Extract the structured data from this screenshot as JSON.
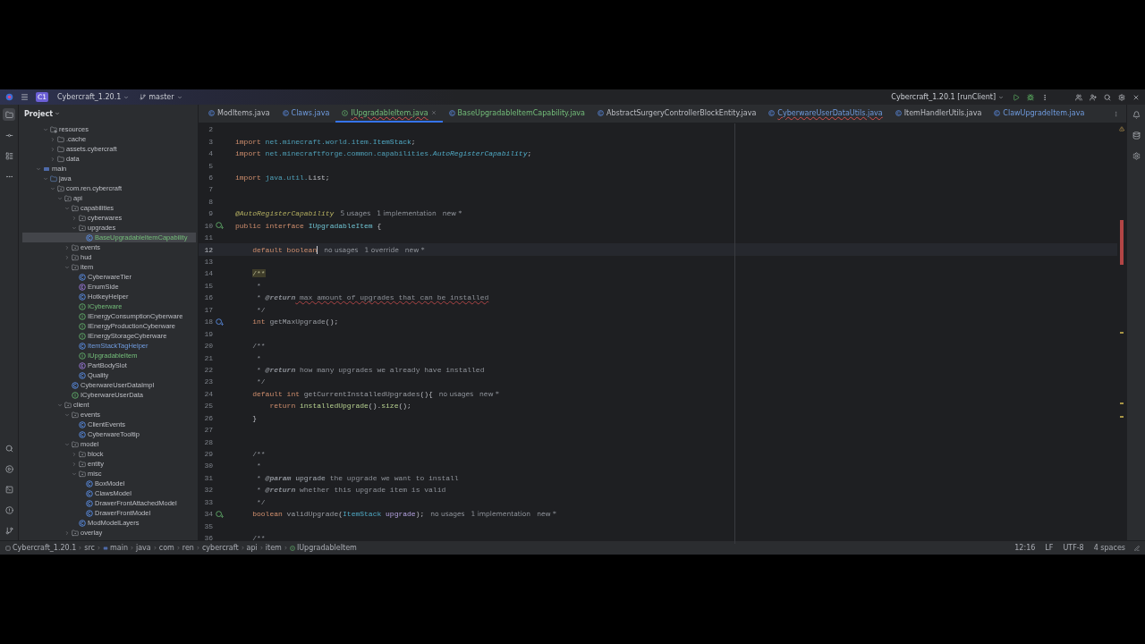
{
  "toolbar": {
    "project_badge": "C1",
    "project": "Cybercraft_1.20.1",
    "branch": "master",
    "run_config": "Cybercraft_1.20.1 [runClient]"
  },
  "project_panel": {
    "title": "Project",
    "tree": [
      {
        "children": [
          {
            "name": "resources",
            "kind": "resources",
            "expanded": true,
            "selected": false,
            "children": [
              {
                "name": ".cache",
                "kind": "folder",
                "expanded": false,
                "selected": false
              },
              {
                "name": "assets.cybercraft",
                "kind": "folder",
                "expanded": false,
                "selected": false
              },
              {
                "name": "data",
                "kind": "folder",
                "expanded": false,
                "selected": false
              }
            ]
          }
        ]
      },
      {
        "name": "main",
        "kind": "module",
        "expanded": true,
        "selected": false,
        "children": [
          {
            "name": "java",
            "kind": "source",
            "expanded": true,
            "selected": false,
            "children": [
              {
                "name": "com.ren.cybercraft",
                "kind": "package",
                "expanded": true,
                "selected": false,
                "children": [
                  {
                    "name": "api",
                    "kind": "package",
                    "expanded": true,
                    "selected": false,
                    "children": [
                      {
                        "name": "capabilities",
                        "kind": "package",
                        "expanded": true,
                        "selected": false,
                        "children": [
                          {
                            "name": "cyberwares",
                            "kind": "package",
                            "expanded": false,
                            "selected": false
                          },
                          {
                            "name": "upgrades",
                            "kind": "package",
                            "expanded": true,
                            "selected": false,
                            "children": [
                              {
                                "name": "BaseUpgradableItemCapability",
                                "kind": "class",
                                "added": true,
                                "selected": true
                              }
                            ]
                          }
                        ]
                      },
                      {
                        "name": "events",
                        "kind": "package",
                        "expanded": false,
                        "selected": false
                      },
                      {
                        "name": "hud",
                        "kind": "package",
                        "expanded": false,
                        "selected": false
                      },
                      {
                        "name": "item",
                        "kind": "package",
                        "expanded": true,
                        "selected": false,
                        "children": [
                          {
                            "name": "CyberwareTier",
                            "kind": "class",
                            "selected": false
                          },
                          {
                            "name": "EnumSide",
                            "kind": "enum",
                            "selected": false
                          },
                          {
                            "name": "HotkeyHelper",
                            "kind": "class",
                            "selected": false
                          },
                          {
                            "name": "ICyberware",
                            "kind": "interface",
                            "added": true,
                            "selected": false
                          },
                          {
                            "name": "IEnergyConsumptionCyberware",
                            "kind": "interface",
                            "selected": false
                          },
                          {
                            "name": "IEnergyProductionCyberware",
                            "kind": "interface",
                            "selected": false
                          },
                          {
                            "name": "IEnergyStorageCyberware",
                            "kind": "interface",
                            "selected": false
                          },
                          {
                            "name": "ItemStackTagHelper",
                            "kind": "class",
                            "modified": true,
                            "selected": false
                          },
                          {
                            "name": "IUpgradableItem",
                            "kind": "interface",
                            "added": true,
                            "selected": false
                          },
                          {
                            "name": "PartBodySlot",
                            "kind": "enum",
                            "selected": false
                          },
                          {
                            "name": "Quality",
                            "kind": "class",
                            "selected": false
                          }
                        ]
                      },
                      {
                        "name": "CyberwareUserDataImpl",
                        "kind": "class",
                        "selected": false
                      },
                      {
                        "name": "ICyberwareUserData",
                        "kind": "interface",
                        "selected": false
                      }
                    ]
                  },
                  {
                    "name": "client",
                    "kind": "package",
                    "expanded": true,
                    "selected": false,
                    "children": [
                      {
                        "name": "events",
                        "kind": "package",
                        "expanded": true,
                        "selected": false,
                        "children": [
                          {
                            "name": "ClientEvents",
                            "kind": "class",
                            "selected": false
                          },
                          {
                            "name": "CyberwareTooltip",
                            "kind": "class",
                            "selected": false
                          }
                        ]
                      },
                      {
                        "name": "model",
                        "kind": "package",
                        "expanded": true,
                        "selected": false,
                        "children": [
                          {
                            "name": "block",
                            "kind": "package",
                            "expanded": false,
                            "selected": false
                          },
                          {
                            "name": "entity",
                            "kind": "package",
                            "expanded": false,
                            "selected": false
                          },
                          {
                            "name": "misc",
                            "kind": "package",
                            "expanded": true,
                            "selected": false,
                            "children": [
                              {
                                "name": "BoxModel",
                                "kind": "class",
                                "selected": false
                              },
                              {
                                "name": "ClawsModel",
                                "kind": "class",
                                "selected": false
                              },
                              {
                                "name": "DrawerFrontAttachedModel",
                                "kind": "class",
                                "selected": false
                              },
                              {
                                "name": "DrawerFrontModel",
                                "kind": "class",
                                "selected": false
                              }
                            ]
                          },
                          {
                            "name": "ModModelLayers",
                            "kind": "class",
                            "selected": false
                          }
                        ]
                      },
                      {
                        "name": "overlay",
                        "kind": "package",
                        "expanded": false,
                        "selected": false
                      }
                    ]
                  }
                ]
              }
            ]
          }
        ]
      }
    ]
  },
  "editor": {
    "tabs": [
      {
        "label": "ModItems.java",
        "kind": "class",
        "selected": false,
        "error": false
      },
      {
        "label": "Claws.java",
        "kind": "class",
        "modified": true,
        "selected": false,
        "error": false
      },
      {
        "label": "IUpgradableItem.java",
        "kind": "interface",
        "added": true,
        "selected": true,
        "error": true
      },
      {
        "label": "BaseUpgradableItemCapability.java",
        "kind": "class",
        "added": true,
        "selected": false,
        "error": false
      },
      {
        "label": "AbstractSurgeryControllerBlockEntity.java",
        "kind": "class",
        "selected": false,
        "error": false
      },
      {
        "label": "CyberwareUserDataUtils.java",
        "kind": "class",
        "modified": true,
        "selected": false,
        "error": true
      },
      {
        "label": "ItemHandlerUtils.java",
        "kind": "class",
        "selected": false,
        "error": false
      },
      {
        "label": "ClawUpgradeItem.java",
        "kind": "class",
        "modified": true,
        "selected": false,
        "error": false
      }
    ],
    "lines": [
      {
        "number": "2",
        "current": false
      },
      {
        "number": "3",
        "current": false,
        "tokens": [
          {
            "kind": "keyword",
            "text": "import"
          },
          {
            "kind": "package",
            "text": " net.minecraft.world.item."
          },
          {
            "kind": "type",
            "text": "ItemStack"
          },
          {
            "kind": "plain",
            "text": ";"
          }
        ]
      },
      {
        "number": "4",
        "current": false,
        "tokens": [
          {
            "kind": "keyword",
            "text": "import"
          },
          {
            "kind": "package",
            "text": " net.minecraftforge.common.capabilities."
          },
          {
            "kind": "italic",
            "text": "AutoRegisterCapability"
          },
          {
            "kind": "plain",
            "text": ";"
          }
        ]
      },
      {
        "number": "5",
        "current": false
      },
      {
        "number": "6",
        "current": false,
        "tokens": [
          {
            "kind": "keyword",
            "text": "import"
          },
          {
            "kind": "package",
            "text": " java.util."
          },
          {
            "kind": "plain",
            "text": "List;"
          }
        ]
      },
      {
        "number": "7",
        "current": false
      },
      {
        "number": "8",
        "current": false
      },
      {
        "number": "9",
        "current": false,
        "tokens": [
          {
            "kind": "annotation",
            "text": "@AutoRegisterCapability"
          },
          {
            "kind": "hint",
            "text": "5 usages"
          },
          {
            "kind": "hint",
            "text": "1 implementation"
          },
          {
            "kind": "hint",
            "text": "new *"
          }
        ]
      },
      {
        "number": "10",
        "kind": "implemented",
        "current": false,
        "tokens": [
          {
            "kind": "keyword",
            "text": "public interface "
          },
          {
            "kind": "classname",
            "text": "IUpgradableItem"
          },
          {
            "kind": "plain",
            "text": " {"
          }
        ]
      },
      {
        "number": "11",
        "current": false
      },
      {
        "number": "12",
        "current": true,
        "tokens": [
          {
            "kind": "keyword",
            "text": "    default boolean"
          },
          {
            "kind": "hint",
            "text": "no usages"
          },
          {
            "kind": "hint",
            "text": "1 override"
          },
          {
            "kind": "hint",
            "text": "new *"
          }
        ]
      },
      {
        "number": "13",
        "current": false
      },
      {
        "number": "14",
        "current": false,
        "tokens": [
          {
            "kind": "doc-highlight",
            "text": "/**"
          }
        ]
      },
      {
        "number": "15",
        "current": false,
        "tokens": [
          {
            "kind": "comment",
            "text": "     *"
          }
        ]
      },
      {
        "number": "16",
        "current": false,
        "tokens": [
          {
            "kind": "comment",
            "text": "     * "
          },
          {
            "kind": "doc-tag",
            "text": "@return"
          },
          {
            "kind": "comment-error",
            "text": " max amount of upgrades that can be installed"
          }
        ]
      },
      {
        "number": "17",
        "current": false,
        "tokens": [
          {
            "kind": "comment",
            "text": "     */"
          }
        ]
      },
      {
        "number": "18",
        "kind": "overridden",
        "current": false,
        "tokens": [
          {
            "kind": "keyword",
            "text": "    int "
          },
          {
            "kind": "method-unused",
            "text": "getMaxUpgrade"
          },
          {
            "kind": "plain",
            "text": "();"
          }
        ]
      },
      {
        "number": "19",
        "current": false
      },
      {
        "number": "20",
        "current": false,
        "tokens": [
          {
            "kind": "comment",
            "text": "    /**"
          }
        ]
      },
      {
        "number": "21",
        "current": false,
        "tokens": [
          {
            "kind": "comment",
            "text": "     *"
          }
        ]
      },
      {
        "number": "22",
        "current": false,
        "tokens": [
          {
            "kind": "comment",
            "text": "     * "
          },
          {
            "kind": "doc-tag",
            "text": "@return"
          },
          {
            "kind": "comment",
            "text": " how many upgrades we already have installed"
          }
        ]
      },
      {
        "number": "23",
        "current": false,
        "tokens": [
          {
            "kind": "comment",
            "text": "     */"
          }
        ]
      },
      {
        "number": "24",
        "current": false,
        "tokens": [
          {
            "kind": "keyword",
            "text": "    default int "
          },
          {
            "kind": "method-unused",
            "text": "getCurrentInstalledUpgrades"
          },
          {
            "kind": "plain",
            "text": "(){"
          },
          {
            "kind": "hint",
            "text": "no usages"
          },
          {
            "kind": "hint",
            "text": "new *"
          }
        ]
      },
      {
        "number": "25",
        "current": false,
        "tokens": [
          {
            "kind": "keyword",
            "text": "        return "
          },
          {
            "kind": "method",
            "text": "installedUpgrade"
          },
          {
            "kind": "plain",
            "text": "()."
          },
          {
            "kind": "method",
            "text": "size"
          },
          {
            "kind": "plain",
            "text": "();"
          }
        ]
      },
      {
        "number": "26",
        "current": false,
        "tokens": [
          {
            "kind": "plain",
            "text": "    }"
          }
        ]
      },
      {
        "number": "27",
        "current": false
      },
      {
        "number": "28",
        "current": false
      },
      {
        "number": "29",
        "current": false,
        "tokens": [
          {
            "kind": "comment",
            "text": "    /**"
          }
        ]
      },
      {
        "number": "30",
        "current": false,
        "tokens": [
          {
            "kind": "comment",
            "text": "     *"
          }
        ]
      },
      {
        "number": "31",
        "current": false,
        "tokens": [
          {
            "kind": "comment",
            "text": "     * "
          },
          {
            "kind": "doc-tag",
            "text": "@param"
          },
          {
            "kind": "doc-param",
            "text": " upgrade"
          },
          {
            "kind": "comment",
            "text": " the upgrade we want to install"
          }
        ]
      },
      {
        "number": "32",
        "current": false,
        "tokens": [
          {
            "kind": "comment",
            "text": "     * "
          },
          {
            "kind": "doc-tag",
            "text": "@return"
          },
          {
            "kind": "comment",
            "text": " whether this upgrade item is valid"
          }
        ]
      },
      {
        "number": "33",
        "current": false,
        "tokens": [
          {
            "kind": "comment",
            "text": "     */"
          }
        ]
      },
      {
        "number": "34",
        "kind": "implemented",
        "current": false,
        "tokens": [
          {
            "kind": "keyword",
            "text": "    boolean "
          },
          {
            "kind": "method-unused",
            "text": "validUpgrade"
          },
          {
            "kind": "plain",
            "text": "("
          },
          {
            "kind": "type",
            "text": "ItemStack"
          },
          {
            "kind": "param",
            "text": " upgrade"
          },
          {
            "kind": "plain",
            "text": ");"
          },
          {
            "kind": "hint",
            "text": "no usages"
          },
          {
            "kind": "hint",
            "text": "1 implementation"
          },
          {
            "kind": "hint",
            "text": "new *"
          }
        ]
      },
      {
        "number": "35",
        "current": false
      },
      {
        "number": "36",
        "current": false,
        "tokens": [
          {
            "kind": "comment",
            "text": "    /**"
          }
        ]
      }
    ]
  },
  "status_bar": {
    "breadcrumbs": [
      {
        "label": "Cybercraft_1.20.1",
        "kind": "project"
      },
      {
        "label": "src",
        "kind": "folder"
      },
      {
        "label": "main",
        "kind": "module"
      },
      {
        "label": "java",
        "kind": "folder"
      },
      {
        "label": "com",
        "kind": "folder"
      },
      {
        "label": "ren",
        "kind": "folder"
      },
      {
        "label": "cybercraft",
        "kind": "folder"
      },
      {
        "label": "api",
        "kind": "folder"
      },
      {
        "label": "item",
        "kind": "folder"
      },
      {
        "label": "IUpgradableItem",
        "kind": "interface"
      }
    ],
    "position": "12:16",
    "line_ending": "LF",
    "encoding": "UTF-8",
    "indent": "4 spaces"
  }
}
